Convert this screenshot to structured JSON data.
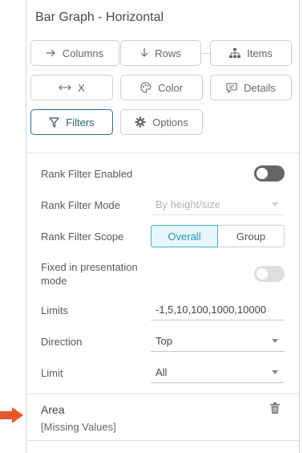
{
  "panel": {
    "title": "Bar Graph - Horizontal"
  },
  "tabs": [
    {
      "label": "Columns",
      "icon": "arrow-right-icon"
    },
    {
      "label": "Rows",
      "icon": "arrow-down-icon"
    },
    {
      "label": "Items",
      "icon": "hierarchy-icon"
    },
    {
      "label": "X",
      "icon": "arrows-horizontal-icon"
    },
    {
      "label": "Color",
      "icon": "palette-icon"
    },
    {
      "label": "Details",
      "icon": "speech-bubble-icon"
    },
    {
      "label": "Filters",
      "icon": "filter-icon",
      "active": true
    },
    {
      "label": "Options",
      "icon": "gear-icon"
    }
  ],
  "filters": {
    "rank_filter_enabled": {
      "label": "Rank Filter Enabled",
      "on": true
    },
    "rank_filter_mode": {
      "label": "Rank Filter Mode",
      "value": "By height/size"
    },
    "rank_filter_scope": {
      "label": "Rank Filter Scope",
      "options": [
        "Overall",
        "Group"
      ],
      "selected": "Overall"
    },
    "fixed_presentation": {
      "label": "Fixed in presentation mode",
      "on": false
    },
    "limits": {
      "label": "Limits",
      "value": "-1,5,10,100,1000,10000"
    },
    "direction": {
      "label": "Direction",
      "value": "Top"
    },
    "limit": {
      "label": "Limit",
      "value": "All"
    }
  },
  "area": {
    "title": "Area",
    "subtitle": "[Missing Values]"
  },
  "colors": {
    "accent": "#3fb1d1",
    "active_border": "#2f6e8f",
    "arrow": "#e8572a"
  }
}
